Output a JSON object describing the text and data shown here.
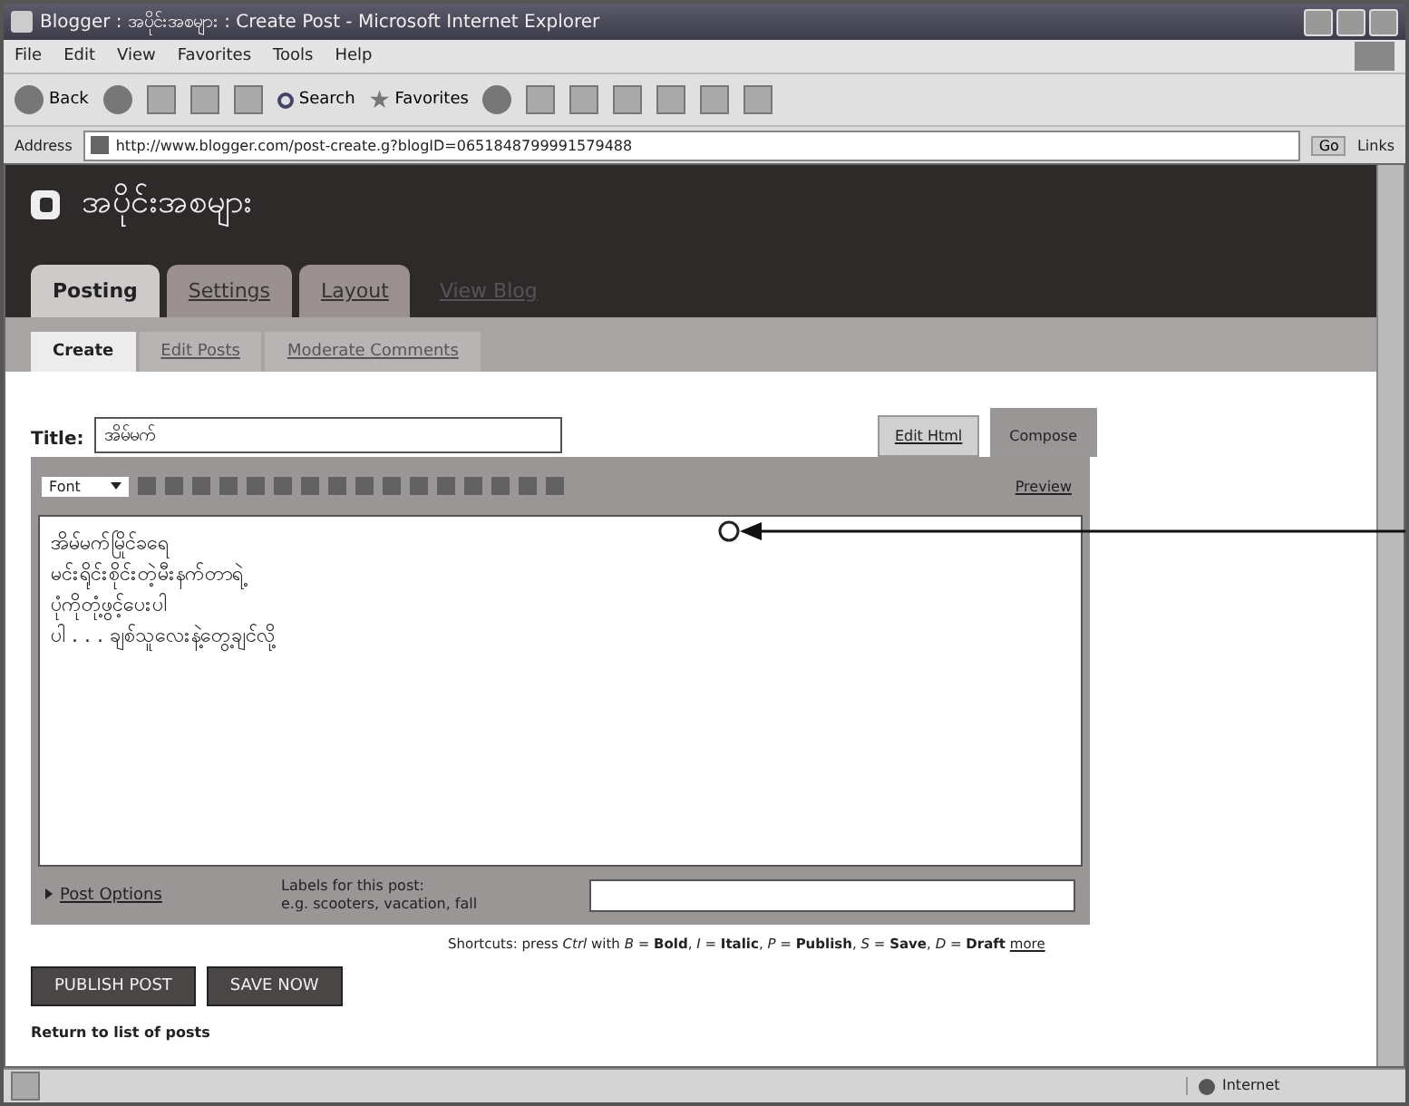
{
  "window": {
    "title": "Blogger : အပိုင်းအစများ : Create Post - Microsoft Internet Explorer"
  },
  "menu": [
    "File",
    "Edit",
    "View",
    "Favorites",
    "Tools",
    "Help"
  ],
  "toolbar": {
    "back": "Back",
    "search": "Search",
    "favorites": "Favorites"
  },
  "address_bar": {
    "label": "Address",
    "url": "http://www.blogger.com/post-create.g?blogID=0651848799991579488",
    "go": "Go",
    "links": "Links"
  },
  "blog": {
    "title": "အပိုင်းအစများ"
  },
  "tabs": [
    {
      "label": "Posting",
      "selected": true
    },
    {
      "label": "Settings",
      "selected": false
    },
    {
      "label": "Layout",
      "selected": false
    },
    {
      "label": "View Blog",
      "selected": false
    }
  ],
  "subtabs": [
    {
      "label": "Create",
      "selected": true
    },
    {
      "label": "Edit Posts",
      "selected": false
    },
    {
      "label": "Moderate Comments",
      "selected": false
    }
  ],
  "post": {
    "title_label": "Title:",
    "title_value": "အိမ်မက်",
    "modes": [
      {
        "label": "Edit Html",
        "selected": false
      },
      {
        "label": "Compose",
        "selected": true
      }
    ],
    "font": "Font",
    "preview": "Preview",
    "body": [
      "အိမ်မက်မြိုင်ခရေ",
      "မင်းရိုင်းစိုင်းတဲ့မီးနက်တာရဲ့",
      "ပုံကိုတုံ့ဖွင့်ပေးပါ",
      "ပါ . . . ချစ်သူလေးနဲ့တွေ့ချင်လို့"
    ],
    "post_options": "Post Options",
    "labels_label": "Labels for this post:",
    "labels_hint": "e.g. scooters, vacation, fall",
    "shortcuts": "Shortcuts: press *Ctrl* with *B* = **Bold**, *I* = **Italic**, *P* = **Publish**, *S* = **Save**, *D* = **Draft**",
    "shortcuts_more": "more",
    "buttons": [
      "PUBLISH POST",
      "SAVE NOW"
    ],
    "return_link": "Return to list of posts"
  },
  "status_bar": {
    "zone": "Internet"
  }
}
